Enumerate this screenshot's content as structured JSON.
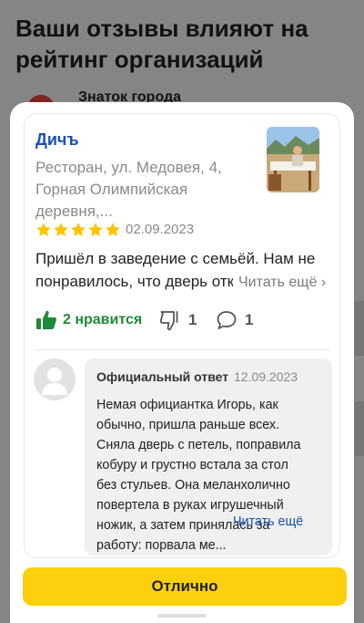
{
  "background": {
    "title": "Ваши отзывы влияют на рейтинг организаций",
    "user_name": "Знаток города"
  },
  "org": {
    "name": "Дичъ",
    "address": "Ресторан, ул. Медовея, 4, Горная Олимпийская деревня,..."
  },
  "review": {
    "rating": 5,
    "date": "02.09.2023",
    "text": "Пришёл в заведение с семьёй. Нам не понравилось, что дверь отк",
    "read_more": "Читать ещё ›"
  },
  "reactions": {
    "like_label": "2 нравится",
    "dislike_count": "1",
    "comment_count": "1"
  },
  "reply": {
    "title": "Официальный ответ",
    "date": "12.09.2023",
    "text": "Немая официантка Игорь, как обычно, пришла раньше всех. Сняла дверь с петель, поправила кобуру и грустно встала за стол без стульев. Она меланхолично повертела в руках игрушечный ножик, а затем принялась за работу: порвала ме...",
    "read_more": "Читать ещё"
  },
  "action": {
    "button_label": "Отлично"
  },
  "colors": {
    "accent_yellow": "#fcd00c",
    "link_blue": "#1a4fb5",
    "like_green": "#1f8a3a",
    "star_yellow": "#fcc400"
  }
}
